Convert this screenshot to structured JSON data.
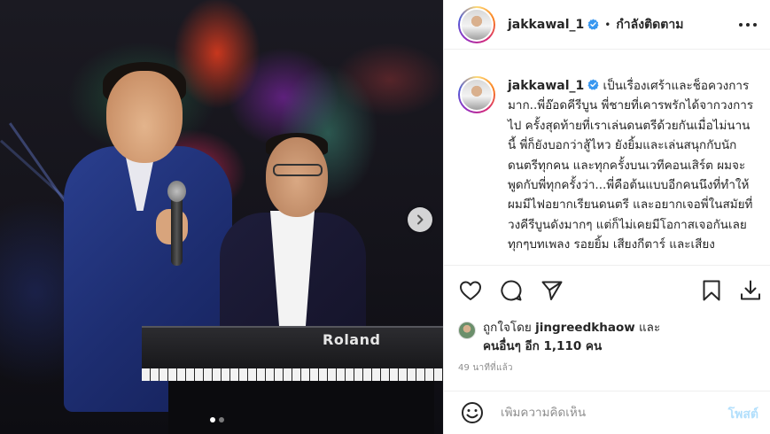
{
  "post": {
    "username": "jakkawal_1",
    "follow_label": "กำลังติดตาม",
    "caption": "เป็นเรื่องเศร้าและช็อควงการมาก..พี่อ๊อดคีรีบูน พี่ชายที่เคารพรักได้จากวงการไป ครั้งสุดท้ายที่เราเล่นดนตรีด้วยกันเมื่อไม่นานนี้ พี่ก็ยังบอกว่าสู้ไหว ยังยิ้มและเล่นสนุกกับนักดนตรีทุกคน และทุกครั้งบนเวทีคอนเสิร์ต ผมจะพูดกับพี่ทุกครั้งว่า...พี่คือต้นแบบอีกคนนึงที่ทำให้ผมมีไฟอยากเรียนดนตรี และอยากเจอพี่ในสมัยที่วงคีรีบูนดังมากๆ แต่ก็ไม่เคยมีโอกาสเจอกันเลย ทุกๆบทเพลง รอยยิ้ม เสียงกีตาร์ และเสียง",
    "liked_prefix": "ถูกใจโดย",
    "liked_user": "jingreedkhaow",
    "liked_and": "และ",
    "liked_others": "คนอื่นๆ อีก 1,110 คน",
    "time_ago": "49 นาทีที่แล้ว",
    "comment_placeholder": "เพิ่มความคิดเห็น",
    "post_button": "โพสต์",
    "keyboard_brand": "Roland",
    "carousel": {
      "current": 1,
      "total": 2
    }
  },
  "icons": {
    "verified": "verified-badge-icon",
    "more": "more-options-icon",
    "like": "heart-icon",
    "comment": "comment-icon",
    "share": "paper-plane-icon",
    "save": "bookmark-icon",
    "download": "download-icon",
    "emoji": "smiley-icon",
    "next": "chevron-right-icon"
  },
  "colors": {
    "verified": "#3897f0",
    "text": "#262626",
    "muted": "#8e8e8e",
    "post_button": "#b2dffc",
    "border": "#efefef"
  }
}
